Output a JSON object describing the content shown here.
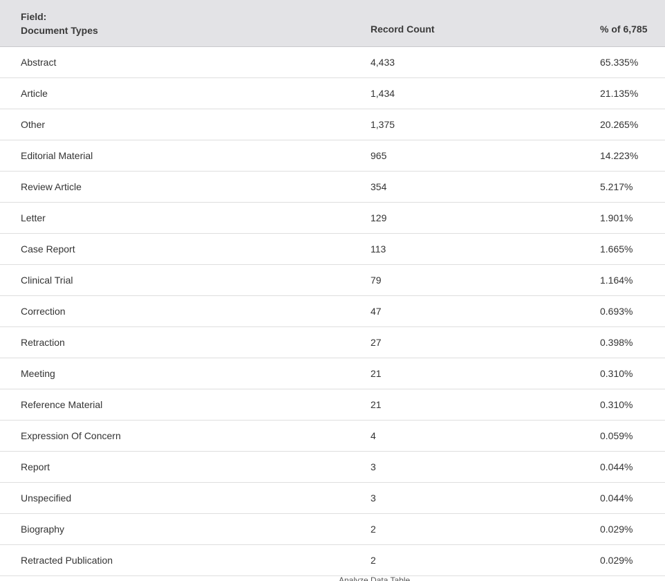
{
  "header": {
    "field_label": "Field:",
    "field_name": "Document Types",
    "count_label": "Record Count",
    "pct_label": "% of 6,785"
  },
  "rows": [
    {
      "name": "Abstract",
      "count": "4,433",
      "pct": "65.335%"
    },
    {
      "name": "Article",
      "count": "1,434",
      "pct": "21.135%"
    },
    {
      "name": "Other",
      "count": "1,375",
      "pct": "20.265%"
    },
    {
      "name": "Editorial Material",
      "count": "965",
      "pct": "14.223%"
    },
    {
      "name": "Review Article",
      "count": "354",
      "pct": "5.217%"
    },
    {
      "name": "Letter",
      "count": "129",
      "pct": "1.901%"
    },
    {
      "name": "Case Report",
      "count": "113",
      "pct": "1.665%"
    },
    {
      "name": "Clinical Trial",
      "count": "79",
      "pct": "1.164%"
    },
    {
      "name": "Correction",
      "count": "47",
      "pct": "0.693%"
    },
    {
      "name": "Retraction",
      "count": "27",
      "pct": "0.398%"
    },
    {
      "name": "Meeting",
      "count": "21",
      "pct": "0.310%"
    },
    {
      "name": "Reference Material",
      "count": "21",
      "pct": "0.310%"
    },
    {
      "name": "Expression Of Concern",
      "count": "4",
      "pct": "0.059%"
    },
    {
      "name": "Report",
      "count": "3",
      "pct": "0.044%"
    },
    {
      "name": "Unspecified",
      "count": "3",
      "pct": "0.044%"
    },
    {
      "name": "Biography",
      "count": "2",
      "pct": "0.029%"
    },
    {
      "name": "Retracted Publication",
      "count": "2",
      "pct": "0.029%"
    }
  ],
  "footer": {
    "link_text": "Analyze Data Table"
  }
}
